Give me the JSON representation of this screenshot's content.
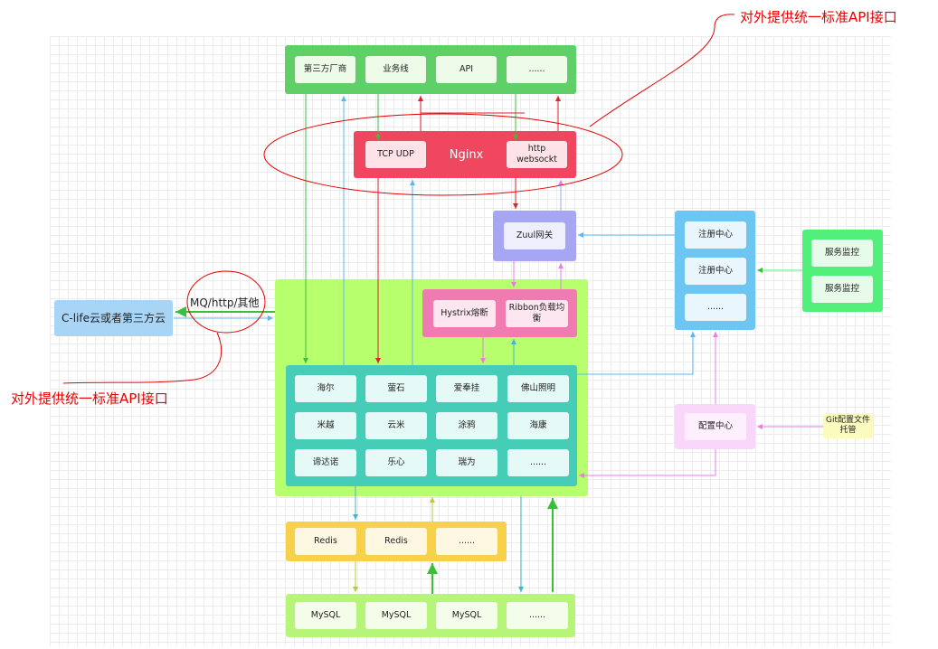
{
  "notes": {
    "top_right": "对外提供统一标准API接口",
    "left": "对外提供统一标准API接口",
    "protocol": "MQ/http/其他"
  },
  "cloud": {
    "label": "C-life云或者第三方云"
  },
  "top_row": [
    "第三方厂商",
    "业务线",
    "API",
    "......"
  ],
  "nginx": {
    "title": "Nginx",
    "left": "TCP UDP",
    "right": "http websockt"
  },
  "zuul": {
    "label": "Zuul网关"
  },
  "hystrix": {
    "label": "Hystrix熔断"
  },
  "ribbon": {
    "label": "Ribbon负载均衡"
  },
  "vendors": [
    [
      "海尔",
      "萤石",
      "爱奉挂",
      "佛山照明"
    ],
    [
      "米越",
      "云米",
      "涂鸦",
      "海康"
    ],
    [
      "谛达诺",
      "乐心",
      "瑞为",
      "......"
    ]
  ],
  "registry": [
    "注册中心",
    "注册中心",
    "......"
  ],
  "monitor": [
    "服务监控",
    "服务监控"
  ],
  "config": {
    "label": "配置中心"
  },
  "git": {
    "label": "Git配置文件托管"
  },
  "redis": [
    "Redis",
    "Redis",
    "......"
  ],
  "mysql": [
    "MySQL",
    "MySQL",
    "MySQL",
    "......"
  ],
  "colors": {
    "green": "#5fd068",
    "red": "#f0465f",
    "purple": "#a6a6f2",
    "pink": "#f07bb0",
    "lime": "#b8ff6e",
    "teal": "#45cdb8",
    "blue": "#6dc6f2",
    "bright_green": "#52f07a",
    "light_pink": "#fbd6fb",
    "yellow": "#f7d14a",
    "pale_green": "#b7f57a",
    "cloud_blue": "#a8d4f5"
  }
}
